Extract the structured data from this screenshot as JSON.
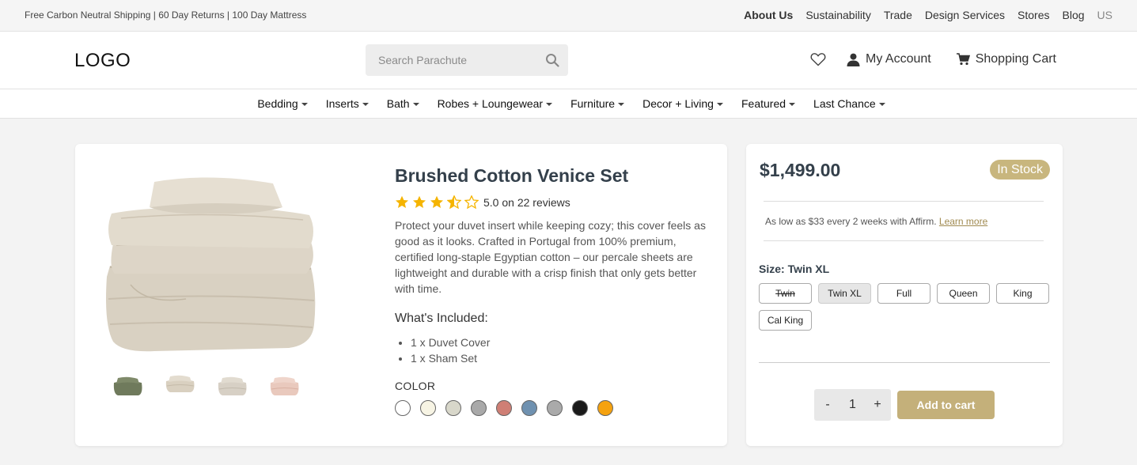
{
  "topbar": {
    "promo": "Free Carbon Neutral Shipping | 60 Day Returns | 100 Day Mattress",
    "links": [
      {
        "label": "About Us",
        "active": true
      },
      {
        "label": "Sustainability"
      },
      {
        "label": "Trade"
      },
      {
        "label": "Design Services"
      },
      {
        "label": "Stores"
      },
      {
        "label": "Blog"
      },
      {
        "label": "US"
      }
    ]
  },
  "header": {
    "logo": "LOGO",
    "search_placeholder": "Search Parachute",
    "account_label": "My Account",
    "cart_label": "Shopping Cart"
  },
  "categories": [
    "Bedding",
    "Inserts",
    "Bath",
    "Robes + Loungewear",
    "Furniture",
    "Decor + Living",
    "Featured",
    "Last Chance"
  ],
  "product": {
    "title": "Brushed Cotton Venice Set",
    "rating_stars": 3.5,
    "rating_text": "5.0 on 22 reviews",
    "description": "Protect your duvet insert while keeping cozy; this cover feels as good as it looks. Crafted in Portugal from 100% premium, certified long-staple Egyptian cotton – our percale sheets are lightweight and durable with a crisp finish that only gets better with time.",
    "included_title": "What's Included:",
    "included_items": [
      "1 x Duvet Cover",
      "1 x Sham Set"
    ],
    "color_label": "COLOR",
    "colors": [
      "#ffffff",
      "#f7f4e4",
      "#d8d7ca",
      "#a9a9a9",
      "#cf7f75",
      "#6f91b0",
      "#aaaaaa",
      "#1a1a1a",
      "#f5a20f"
    ],
    "thumb_colors": [
      "#6f7a5c",
      "#d9d0c0",
      "#d7d0c5",
      "#e9c9bd"
    ]
  },
  "purchase": {
    "price": "$1,499.00",
    "stock": "In Stock",
    "affirm_text": "As low as $33 every 2 weeks with Affirm.",
    "affirm_link": "Learn more",
    "size_label": "Size: Twin XL",
    "sizes": [
      "Twin",
      "Twin XL",
      "Full",
      "Queen",
      "King",
      "Cal King"
    ],
    "selected_size": "Twin XL",
    "unavailable_size": "Twin",
    "quantity": "1",
    "minus": "-",
    "plus": "+",
    "add_to_cart": "Add to cart"
  },
  "colors": {
    "accent": "#c4b07a",
    "star": "#f5b400",
    "title": "#34404b"
  }
}
